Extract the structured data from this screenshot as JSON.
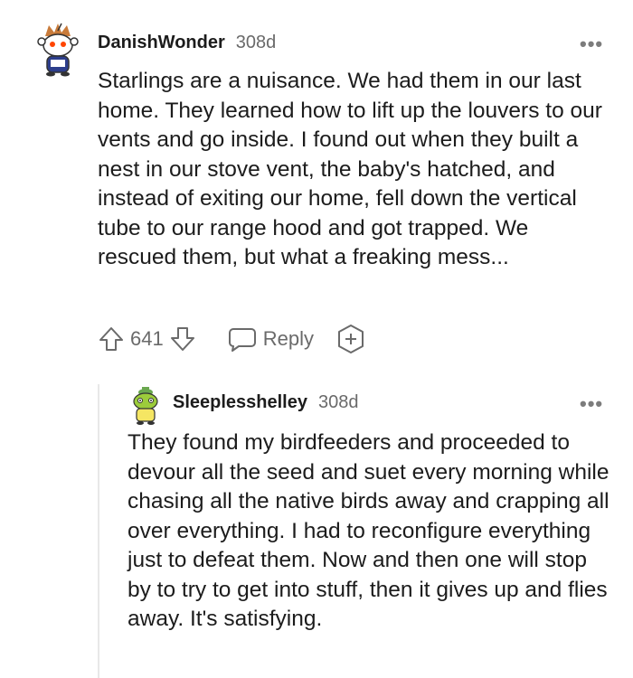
{
  "comments": [
    {
      "username": "DanishWonder",
      "age": "308d",
      "text": "Starlings are a nuisance. We had them in our last home. They learned how to lift up the louvers to our vents and go inside. I found out when they built a nest in our stove vent, the baby's hatched, and instead of exiting our home, fell down the vertical tube to our range hood and got trapped. We rescued them, but what a freaking mess...",
      "score": "641",
      "reply_label": "Reply"
    },
    {
      "username": "Sleeplesshelley",
      "age": "308d",
      "text": "They found my birdfeeders and proceeded to devour all the seed and suet every morning while chasing all the native birds away and crapping all over everything. I had to reconfigure everything just to defeat them. Now and then one will stop by to try to get into stuff, then it gives up and flies away. It's satisfying."
    }
  ],
  "icons": {
    "more": "more-options-icon",
    "upvote": "upvote-arrow-icon",
    "downvote": "downvote-arrow-icon",
    "reply": "chat-bubble-icon",
    "award": "award-plus-icon"
  },
  "colors": {
    "text": "#1c1c1c",
    "meta": "#6a6a6a",
    "thread_line": "#e8e8e8"
  }
}
